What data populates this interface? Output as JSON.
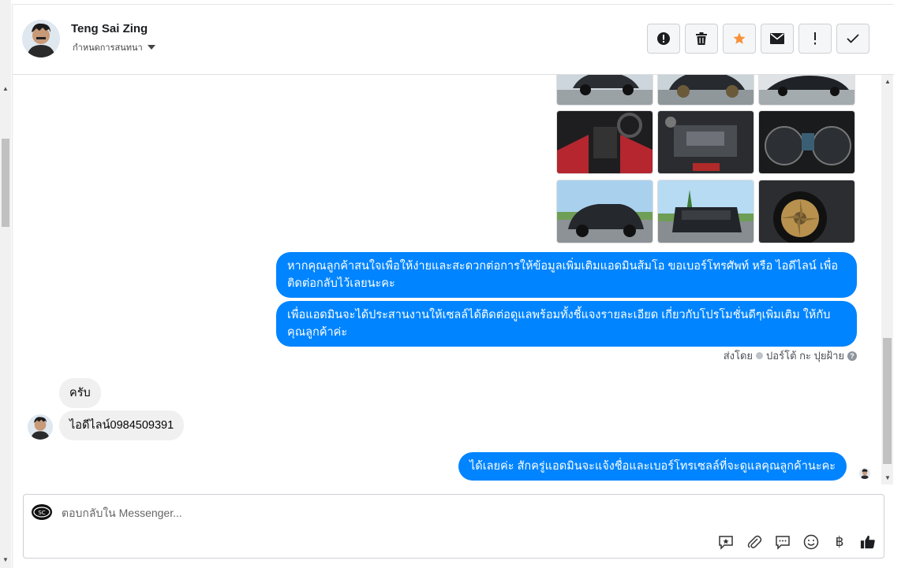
{
  "header": {
    "name": "Teng Sai Zing",
    "subtitle": "กำหนดการสนทนา",
    "actions": [
      "alert-circle-icon",
      "trash-icon",
      "star-icon",
      "envelope-icon",
      "exclamation-icon",
      "check-icon"
    ],
    "star_color": "#f7923b"
  },
  "messages": {
    "out_1": "หากคุณลูกค้าสนใจเพื่อให้ง่ายและสะดวกต่อการให้ข้อมูลเพิ่มเติมแอดมินส้มโอ ขอเบอร์โทรศัพท์ หรือ ไอดีไลน์ เพื่อติดต่อกลับไว้เลยนะคะ",
    "out_2": "เพื่อแอดมินจะได้ประสานงานให้เซลล์ได้ติดต่อดูแลพร้อมทั้งชี้แจงรายละเอียด เกี่ยวกับโปรโมชั่นดีๆเพิ่มเติม ให้กับคุณลูกค้าค่ะ",
    "sent_by_label": "ส่งโดย",
    "sent_by_name": "ปอร์โต้ กะ ปุยฝ้าย",
    "in_1": "ครับ",
    "in_2": "ไอดีไลน์0984509391",
    "out_3": "ได้เลยค่ะ สักครู่แอดมินจะแจ้งชื่อและเบอร์โทรเซลล์ที่จะดูแลคุณลูกค้านะคะ"
  },
  "composer": {
    "placeholder": "ตอบกลับใน Messenger...",
    "tools": [
      "saved-reply-icon",
      "paperclip-icon",
      "chat-bubble-icon",
      "emoji-icon",
      "baht-icon",
      "thumbs-up-icon"
    ],
    "baht_symbol": "฿"
  },
  "colors": {
    "outgoing_bubble": "#0084ff",
    "incoming_bubble": "#f0f0f0"
  }
}
